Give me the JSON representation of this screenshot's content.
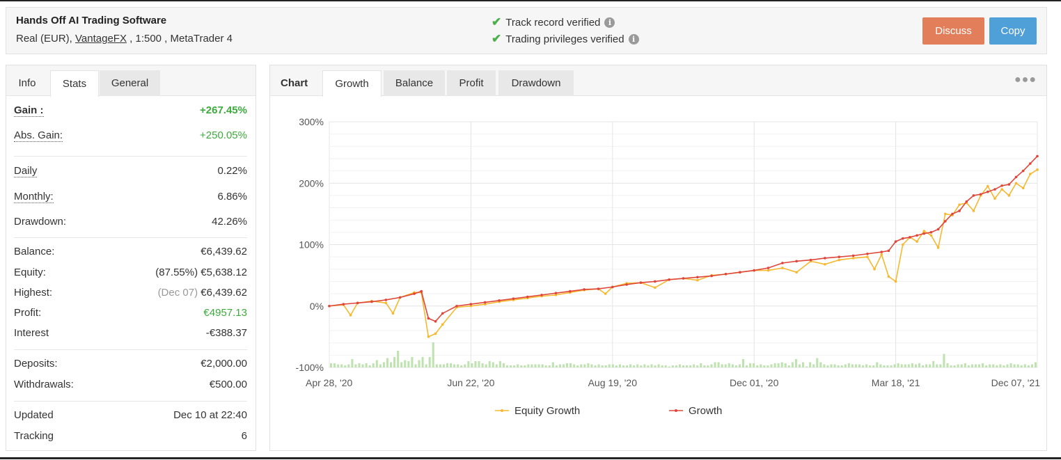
{
  "header": {
    "system_name": "Hands Off AI Trading Software",
    "account_prefix": "Real (EUR), ",
    "broker": "VantageFX",
    "account_suffix": " , 1:500 , MetaTrader 4",
    "verified_track": "Track record verified",
    "verified_trading": "Trading privileges verified",
    "discuss_label": "Discuss",
    "copy_label": "Copy"
  },
  "left_tabs": [
    "Info",
    "Stats",
    "General"
  ],
  "stats": {
    "gain_label": "Gain :",
    "gain_value": "+267.45%",
    "abs_gain_label": "Abs. Gain:",
    "abs_gain_value": "+250.05%",
    "daily_label": "Daily",
    "daily_value": "0.22%",
    "monthly_label": "Monthly:",
    "monthly_value": "6.86%",
    "drawdown_label": "Drawdown:",
    "drawdown_value": "42.26%",
    "balance_label": "Balance:",
    "balance_value": "€6,439.62",
    "equity_label": "Equity:",
    "equity_value": "(87.55%) €5,638.12",
    "highest_label": "Highest:",
    "highest_date": "(Dec 07)",
    "highest_value": " €6,439.62",
    "profit_label": "Profit:",
    "profit_value": "€4957.13",
    "interest_label": "Interest",
    "interest_value": "-€388.37",
    "deposits_label": "Deposits:",
    "deposits_value": "€2,000.00",
    "withdrawals_label": "Withdrawals:",
    "withdrawals_value": "€500.00",
    "updated_label": "Updated",
    "updated_value": "Dec 10 at 22:40",
    "tracking_label": "Tracking",
    "tracking_value": "6"
  },
  "chart_tabs": {
    "label": "Chart",
    "tabs": [
      "Growth",
      "Balance",
      "Profit",
      "Drawdown"
    ],
    "active": "Growth"
  },
  "colors": {
    "growth": "#e0453a",
    "equity": "#f5b82e",
    "bars": "#bfe3b0",
    "positive": "#3cab3c",
    "discuss": "#e27f5a",
    "copy": "#4f9fd8"
  },
  "chart_data": {
    "type": "line",
    "x_tick_labels": [
      "Apr 28, '20",
      "Jun 22, '20",
      "Aug 19, '20",
      "Dec 01, '20",
      "Mar 18, '21",
      "Dec 07, '21"
    ],
    "y_tick_labels": [
      "300%",
      "200%",
      "100%",
      "0%",
      "-100%"
    ],
    "ylim": [
      -100,
      300
    ],
    "grid": true,
    "legend": "bottom",
    "series": [
      {
        "name": "Growth",
        "x": [
          0,
          4,
          8,
          12,
          16,
          20,
          24,
          26,
          28,
          30,
          32,
          36,
          40,
          44,
          48,
          52,
          56,
          60,
          64,
          68,
          72,
          76,
          80,
          84,
          88,
          92,
          96,
          100,
          104,
          108,
          112,
          116,
          120,
          124,
          128,
          132,
          136,
          140,
          144,
          148,
          152,
          156,
          158,
          160,
          162,
          164,
          166,
          168,
          170,
          172,
          174,
          176,
          178,
          180,
          182,
          184,
          186,
          188,
          190,
          192,
          194,
          196,
          198,
          200
        ],
        "values": [
          0,
          3,
          5,
          7,
          10,
          14,
          20,
          24,
          -20,
          -25,
          -12,
          0,
          3,
          6,
          9,
          12,
          15,
          18,
          21,
          24,
          27,
          28,
          31,
          35,
          38,
          40,
          43,
          45,
          47,
          49,
          52,
          55,
          58,
          62,
          70,
          73,
          75,
          78,
          80,
          82,
          85,
          88,
          90,
          105,
          110,
          112,
          115,
          118,
          120,
          125,
          138,
          150,
          155,
          170,
          180,
          182,
          186,
          190,
          196,
          198,
          210,
          220,
          232,
          244
        ],
        "markers": true
      },
      {
        "name": "Equity Growth",
        "x": [
          0,
          4,
          6,
          8,
          12,
          16,
          18,
          20,
          24,
          26,
          28,
          30,
          32,
          36,
          40,
          44,
          48,
          52,
          56,
          60,
          64,
          68,
          72,
          76,
          78,
          80,
          84,
          88,
          92,
          96,
          100,
          104,
          108,
          112,
          116,
          120,
          124,
          128,
          132,
          136,
          140,
          144,
          148,
          152,
          154,
          156,
          158,
          160,
          162,
          164,
          166,
          168,
          170,
          172,
          174,
          176,
          178,
          180,
          182,
          184,
          186,
          188,
          190,
          192,
          194,
          196,
          198,
          200
        ],
        "values": [
          0,
          2,
          -15,
          5,
          8,
          5,
          -12,
          14,
          22,
          22,
          -50,
          -45,
          -30,
          -2,
          0,
          3,
          7,
          10,
          13,
          16,
          18,
          22,
          26,
          28,
          20,
          31,
          37,
          38,
          30,
          43,
          45,
          42,
          50,
          52,
          55,
          58,
          58,
          62,
          55,
          73,
          68,
          75,
          78,
          80,
          60,
          84,
          48,
          40,
          100,
          112,
          105,
          122,
          115,
          95,
          150,
          148,
          165,
          168,
          155,
          180,
          195,
          175,
          190,
          180,
          200,
          192,
          215,
          222
        ],
        "markers": true
      }
    ],
    "bars": {
      "name": "Volume",
      "values": [
        4,
        4,
        3,
        3,
        2,
        3,
        8,
        3,
        4,
        3,
        4,
        2,
        4,
        7,
        3,
        5,
        9,
        5,
        10,
        16,
        5,
        7,
        6,
        10,
        3,
        7,
        10,
        3,
        10,
        24,
        3,
        3,
        3,
        4,
        4,
        3,
        3,
        2,
        3,
        6,
        4,
        6,
        6,
        4,
        3,
        6,
        5,
        3,
        6,
        4,
        2,
        2,
        2,
        3,
        2,
        2,
        3,
        3,
        3,
        3,
        3,
        2,
        2,
        5,
        2,
        3,
        3,
        4,
        4,
        3,
        2,
        3,
        3,
        4,
        3,
        2,
        3,
        2,
        2,
        3,
        3,
        2,
        3,
        2,
        2,
        3,
        2,
        3,
        2,
        3,
        2,
        3,
        2,
        3,
        2,
        2,
        1,
        2,
        2,
        3,
        2,
        2,
        2,
        3,
        2,
        4,
        2,
        2,
        3,
        5,
        5,
        3,
        3,
        4,
        3,
        2,
        3,
        8,
        2,
        4,
        4,
        2,
        3,
        2,
        2,
        3,
        4,
        4,
        5,
        4,
        2,
        5,
        8,
        3,
        5,
        1,
        5,
        3,
        9,
        5,
        3,
        2,
        3,
        3,
        2,
        2,
        3,
        4,
        3,
        3,
        3,
        2,
        3,
        2,
        2,
        5,
        3,
        2,
        2,
        2,
        3,
        4,
        3,
        3,
        3,
        4,
        3,
        4,
        2,
        3,
        3,
        6,
        3,
        3,
        13,
        4,
        2,
        2,
        3,
        3,
        4,
        2,
        3,
        3,
        3,
        4,
        2,
        3,
        3,
        2,
        3,
        2,
        3,
        4,
        3,
        3,
        2,
        3,
        2,
        3,
        5
      ]
    }
  }
}
